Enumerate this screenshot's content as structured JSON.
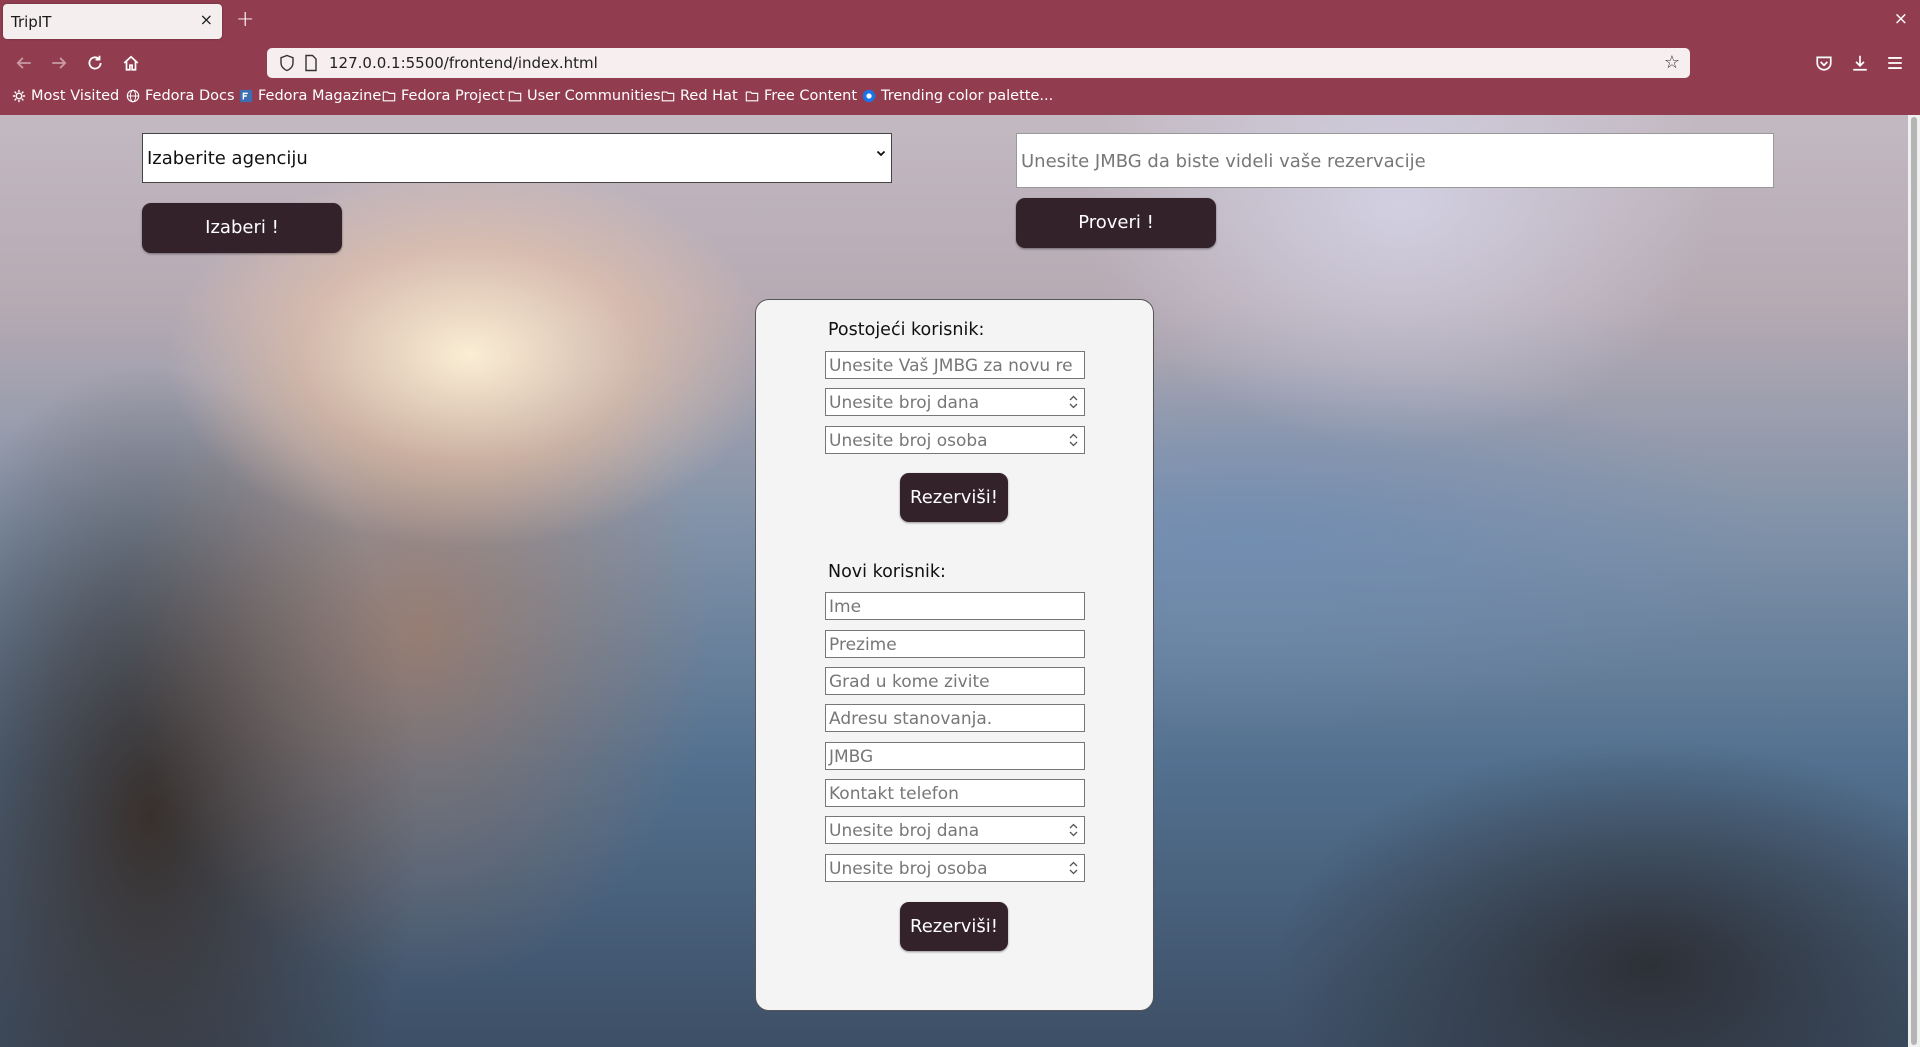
{
  "browser": {
    "tab_title": "TripIT",
    "tab_close_icon": "×",
    "new_tab_icon": "+",
    "window_close_icon": "×",
    "url": "127.0.0.1:5500/frontend/index.html",
    "bookmarks": [
      {
        "label": "Most Visited",
        "icon": "gear-icon"
      },
      {
        "label": "Fedora Docs",
        "icon": "globe-icon"
      },
      {
        "label": "Fedora Magazine",
        "icon": "fedora-icon"
      },
      {
        "label": "Fedora Project",
        "icon": "folder-icon"
      },
      {
        "label": "User Communities",
        "icon": "folder-icon"
      },
      {
        "label": "Red Hat",
        "icon": "folder-icon"
      },
      {
        "label": "Free Content",
        "icon": "folder-icon"
      },
      {
        "label": "Trending color palette...",
        "icon": "site-icon"
      }
    ],
    "colors": {
      "chrome": "#913d4f",
      "urlbar": "#f6eeef"
    }
  },
  "page": {
    "agency_select": {
      "selected": "Izaberite agenciju"
    },
    "choose_button": "Izaberi !",
    "jmbg_search": {
      "placeholder": "Unesite JMBG da biste videli vaše rezervacije"
    },
    "check_button": "Proveri !",
    "existing_user": {
      "heading": "Postojeći korisnik:",
      "fields": [
        {
          "placeholder": "Unesite Vaš JMBG za novu re",
          "type": "text"
        },
        {
          "placeholder": "Unesite broj dana",
          "type": "number"
        },
        {
          "placeholder": "Unesite broj osoba",
          "type": "number"
        }
      ],
      "submit": "Rezerviši!"
    },
    "new_user": {
      "heading": "Novi korisnik:",
      "fields": [
        {
          "placeholder": "Ime",
          "type": "text"
        },
        {
          "placeholder": "Prezime",
          "type": "text"
        },
        {
          "placeholder": "Grad u kome zivite",
          "type": "text"
        },
        {
          "placeholder": "Adresu stanovanja.",
          "type": "text"
        },
        {
          "placeholder": "JMBG",
          "type": "text"
        },
        {
          "placeholder": "Kontakt telefon",
          "type": "text"
        },
        {
          "placeholder": "Unesite broj dana",
          "type": "number"
        },
        {
          "placeholder": "Unesite broj osoba",
          "type": "number"
        }
      ],
      "submit": "Rezerviši!"
    },
    "colors": {
      "button": "#33222a",
      "card": "#f4f4f4"
    }
  }
}
